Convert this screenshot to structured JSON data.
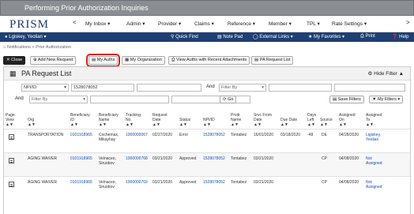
{
  "title": "Performing Prior Authorization Inquiries",
  "logo": "PRISM",
  "nav": {
    "back": "<",
    "forward": ">",
    "menus": [
      "My Inbox ▾",
      "Admin ▾",
      "Provider ▾",
      "Claims ▾",
      "Reference ▾",
      "Member ▾",
      "TPL ▾",
      "Rate Settings ▾"
    ]
  },
  "userbar": {
    "user": "Lgiskey, Yeolian ▾",
    "quick_find": "Quick Find",
    "note_pad": "Note Pad",
    "external_links": "External Links ▾",
    "my_favorites": "My Favorites ▾",
    "print": "Print",
    "help": "Help"
  },
  "breadcrumb": "Notifications > Prior Authorization",
  "toolbar": {
    "close": "Close",
    "add_new_request": "Add New Request",
    "my_auths": "My Auths",
    "my_organization": "My Organization",
    "view_recent_attachments": "View Auths with Recent Attachments",
    "pa_request_list": "PA Request List"
  },
  "panel": {
    "title": "PA Request List",
    "hide_filter": "Hide Filter"
  },
  "filter": {
    "f1_field": "NPI/ID",
    "f1_value": "1528078052",
    "and1": "And",
    "f2_placeholder": "Filter By",
    "and2": "And",
    "f3_placeholder": "Filter By",
    "go": "Go",
    "save_filters": "Save Filters",
    "my_filters": "My Filters ▾"
  },
  "columns": [
    {
      "l1": "Page",
      "l2": "View"
    },
    {
      "l1": "",
      "l2": "Org"
    },
    {
      "l1": "Beneficiary",
      "l2": "ID"
    },
    {
      "l1": "Beneficiary",
      "l2": "Name"
    },
    {
      "l1": "Tracking",
      "l2": "No."
    },
    {
      "l1": "Request",
      "l2": "Date"
    },
    {
      "l1": "",
      "l2": "Status"
    },
    {
      "l1": "",
      "l2": "NPI/ID"
    },
    {
      "l1": "Prvdr",
      "l2": "Name"
    },
    {
      "l1": "Srvc From",
      "l2": "Date"
    },
    {
      "l1": "",
      "l2": "Due Date"
    },
    {
      "l1": "Days",
      "l2": "Left"
    },
    {
      "l1": "",
      "l2": "Source"
    },
    {
      "l1": "Assigned",
      "l2": "On"
    },
    {
      "l1": "Assigned",
      "l2": "To"
    }
  ],
  "sort_glyph": "▲▼",
  "rows": [
    {
      "org": "TRANSPORTATION",
      "ben_id": "0101918965",
      "ben_name_1": "Cochemax,",
      "ben_name_2": "Mikayhay",
      "tracking": "1000000067",
      "req_date": "02/27/2020",
      "status": "Error",
      "npi": "1528078052",
      "prvdr": "Tontabez",
      "srvc_from": "16/01/2020",
      "due": "03/18/2020",
      "days": "-48",
      "source": "DE",
      "assigned_on": "04/28/2020",
      "assigned_to_1": "Ligiskey,",
      "assigned_to_2": "Yeolian"
    },
    {
      "org": "AGING WAIVER",
      "ben_id": "0101918965",
      "ben_name_1": "Velnaceo,",
      "ben_name_2": "Siruobov",
      "tracking": "1000000768",
      "req_date": "03/21/2020",
      "status": "Approved",
      "npi": "1528078052",
      "prvdr": "Tontabez",
      "srvc_from": "03/21/2020",
      "due": "",
      "days": "",
      "source": "CP",
      "assigned_on": "04/08/2020",
      "assigned_to_1": "Not",
      "assigned_to_2": "Assigned"
    },
    {
      "org": "AGING WAIVER",
      "ben_id": "0101918965",
      "ben_name_1": "Velnaceo,",
      "ben_name_2": "Siruobov",
      "tracking": "1000000769",
      "req_date": "03/21/2020",
      "status": "Approved",
      "npi": "1528078052",
      "prvdr": "Tontabez",
      "srvc_from": "03/21/2020",
      "due": "",
      "days": "",
      "source": "CP",
      "assigned_on": "04/08/2020",
      "assigned_to_1": "Not",
      "assigned_to_2": "Assigned"
    }
  ]
}
